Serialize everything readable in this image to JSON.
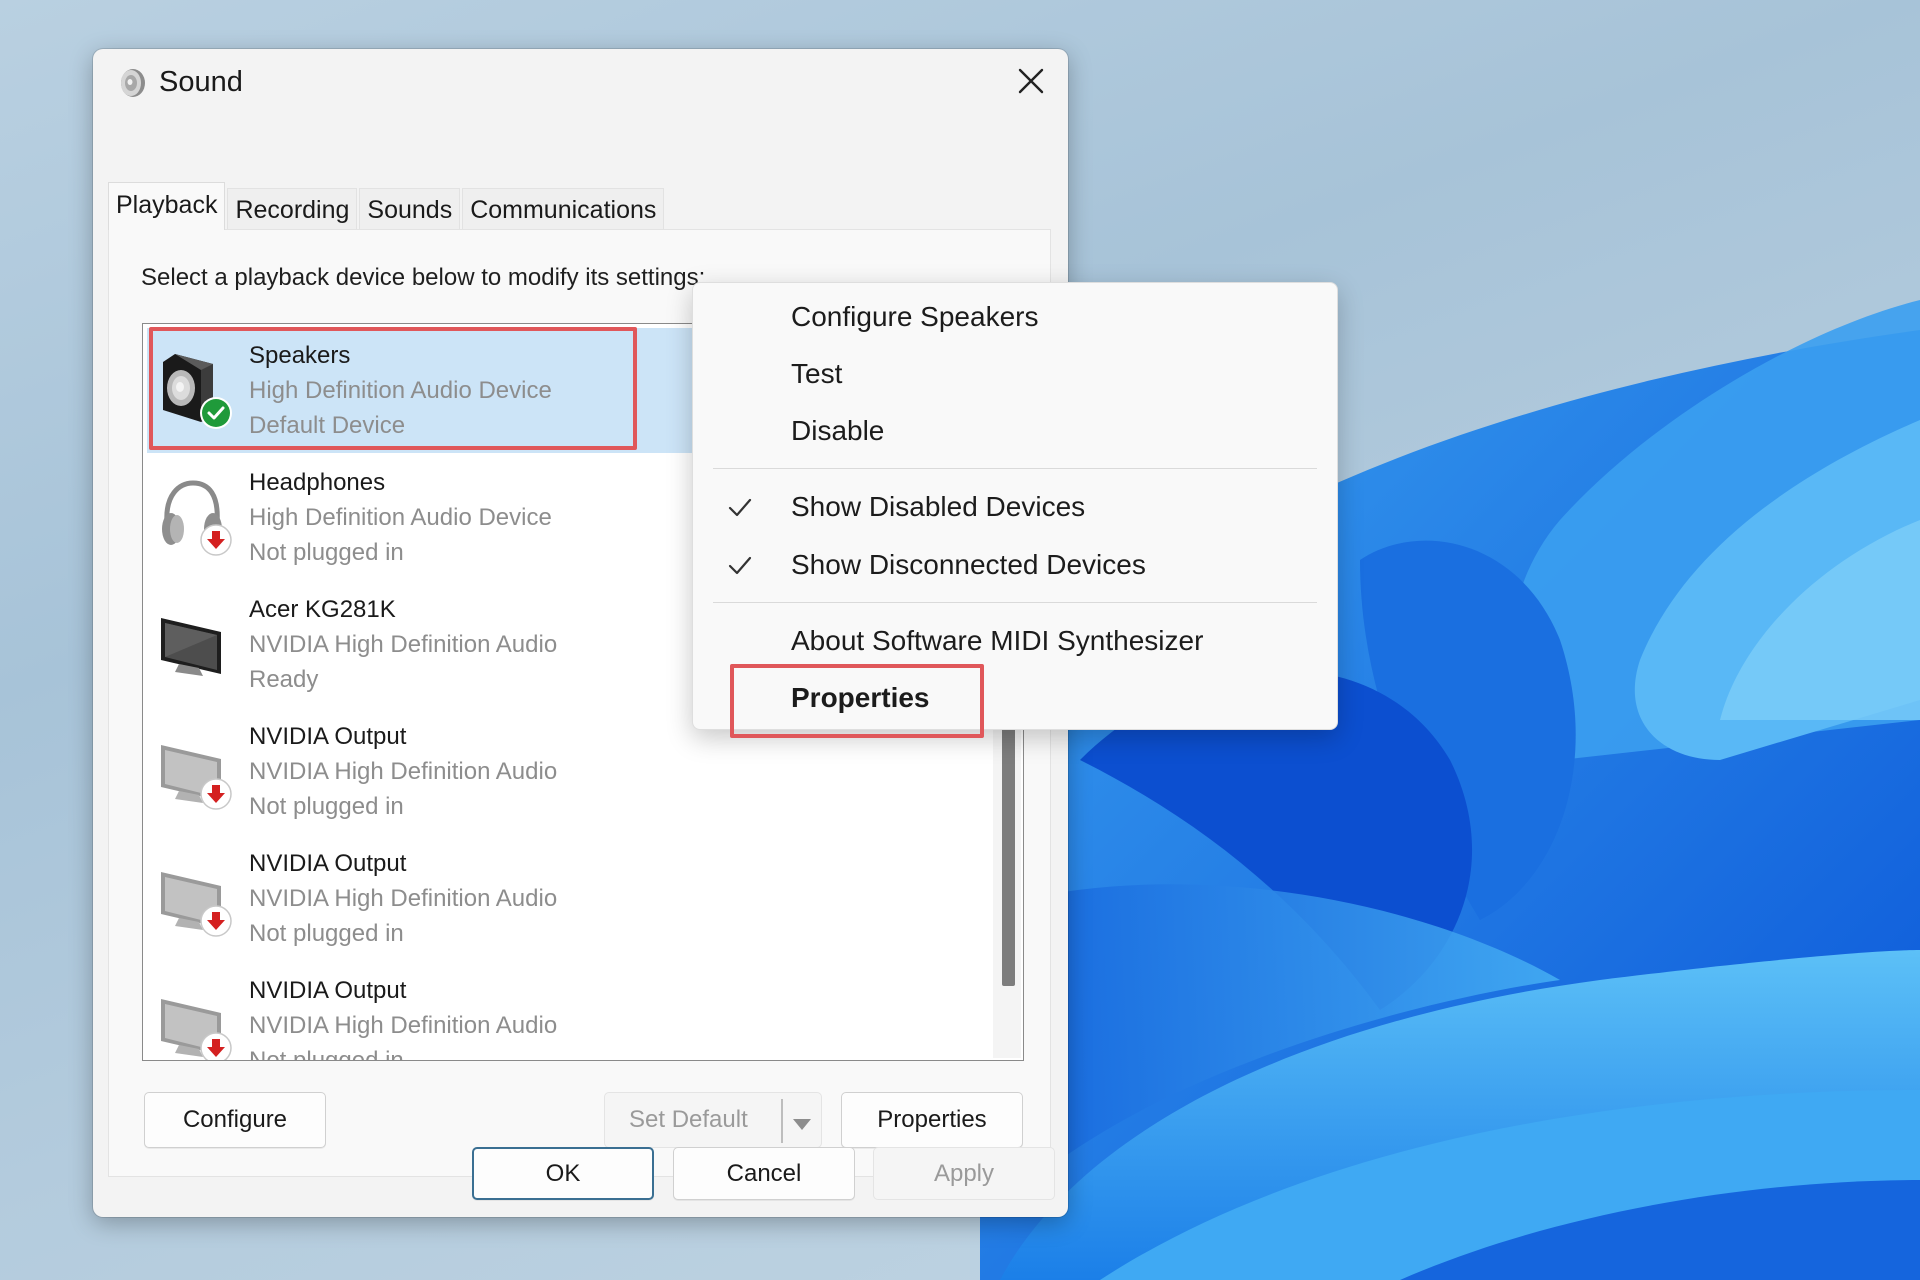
{
  "dialog": {
    "title": "Sound",
    "title_icon": "speaker-icon",
    "close_icon": "close-icon",
    "tabs": [
      {
        "label": "Playback",
        "active": true
      },
      {
        "label": "Recording",
        "active": false
      },
      {
        "label": "Sounds",
        "active": false
      },
      {
        "label": "Communications",
        "active": false
      }
    ],
    "instruction": "Select a playback device below to modify its settings:",
    "devices": [
      {
        "name": "Speakers",
        "driver": "High Definition Audio Device",
        "status": "Default Device",
        "icon": "speaker-icon",
        "badge": "default-check-icon",
        "selected": true
      },
      {
        "name": "Headphones",
        "driver": "High Definition Audio Device",
        "status": "Not plugged in",
        "icon": "headphones-icon",
        "badge": "unplugged-arrow-icon",
        "selected": false
      },
      {
        "name": "Acer KG281K",
        "driver": "NVIDIA High Definition Audio",
        "status": "Ready",
        "icon": "monitor-icon",
        "badge": "",
        "selected": false
      },
      {
        "name": "NVIDIA Output",
        "driver": "NVIDIA High Definition Audio",
        "status": "Not plugged in",
        "icon": "monitor-icon",
        "badge": "unplugged-arrow-icon",
        "selected": false
      },
      {
        "name": "NVIDIA Output",
        "driver": "NVIDIA High Definition Audio",
        "status": "Not plugged in",
        "icon": "monitor-icon",
        "badge": "unplugged-arrow-icon",
        "selected": false
      },
      {
        "name": "NVIDIA Output",
        "driver": "NVIDIA High Definition Audio",
        "status": "Not plugged in",
        "icon": "monitor-icon",
        "badge": "unplugged-arrow-icon",
        "selected": false
      }
    ],
    "buttons": {
      "configure": "Configure",
      "set_default": "Set Default",
      "properties": "Properties",
      "ok": "OK",
      "cancel": "Cancel",
      "apply": "Apply"
    }
  },
  "context_menu": {
    "items": [
      {
        "label": "Configure Speakers",
        "checked": false,
        "bold": false
      },
      {
        "label": "Test",
        "checked": false,
        "bold": false
      },
      {
        "label": "Disable",
        "checked": false,
        "bold": false
      },
      {
        "label": "Show Disabled Devices",
        "checked": true,
        "bold": false
      },
      {
        "label": "Show Disconnected Devices",
        "checked": true,
        "bold": false
      },
      {
        "label": "About Software MIDI Synthesizer",
        "checked": false,
        "bold": false
      },
      {
        "label": "Properties",
        "checked": false,
        "bold": true
      }
    ]
  },
  "colors": {
    "selection": "#cce4f7",
    "highlight_annotation": "#e0575a",
    "default_badge": "#1f9a3a",
    "unplugged_badge": "#d42020"
  }
}
